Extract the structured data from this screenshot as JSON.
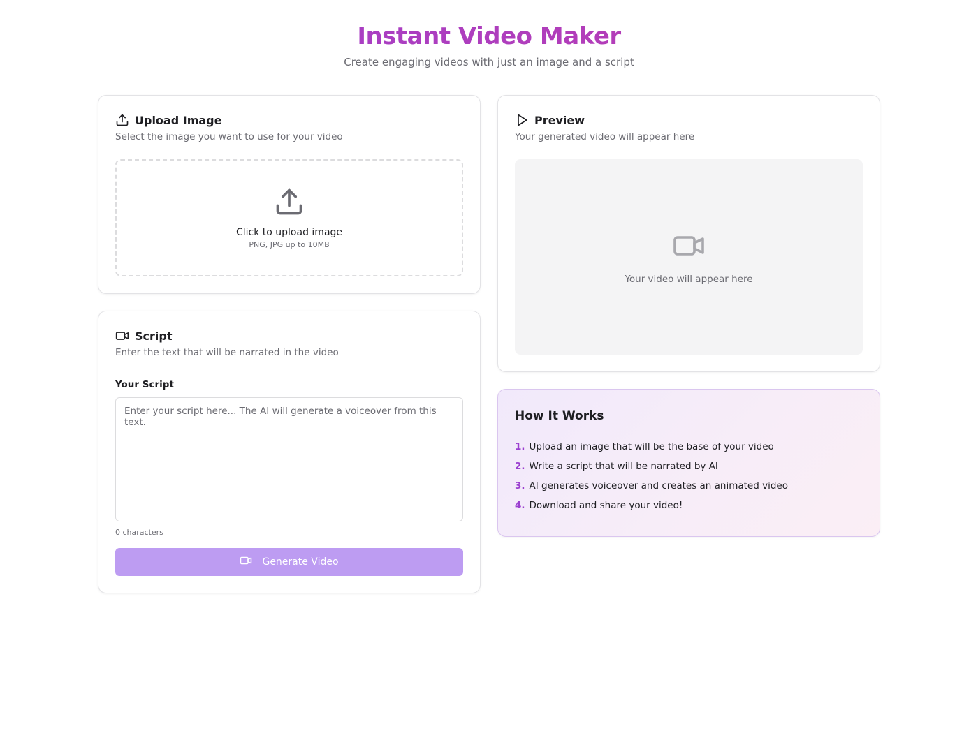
{
  "header": {
    "title": "Instant Video Maker",
    "subtitle": "Create engaging videos with just an image and a script"
  },
  "upload": {
    "title": "Upload Image",
    "description": "Select the image you want to use for your video",
    "dropzone_main": "Click to upload image",
    "dropzone_hint": "PNG, JPG up to 10MB",
    "icon": "upload-icon"
  },
  "script": {
    "title": "Script",
    "description": "Enter the text that will be narrated in the video",
    "field_label": "Your Script",
    "placeholder": "Enter your script here... The AI will generate a voiceover from this text.",
    "value": "",
    "char_count": "0 characters",
    "button_label": "Generate Video",
    "icon": "video-camera-icon"
  },
  "preview": {
    "title": "Preview",
    "description": "Your generated video will appear here",
    "placeholder_text": "Your video will appear here",
    "icon": "play-icon"
  },
  "how_it_works": {
    "title": "How It Works",
    "steps": [
      {
        "num": "1.",
        "text": "Upload an image that will be the base of your video"
      },
      {
        "num": "2.",
        "text": "Write a script that will be narrated by AI"
      },
      {
        "num": "3.",
        "text": "AI generates voiceover and creates an animated video"
      },
      {
        "num": "4.",
        "text": "Download and share your video!"
      }
    ]
  },
  "colors": {
    "accent": "#9b3fd0",
    "accent_pink": "#c13cab",
    "button_disabled": "#bd9cf2",
    "muted_text": "#6b6b72"
  }
}
